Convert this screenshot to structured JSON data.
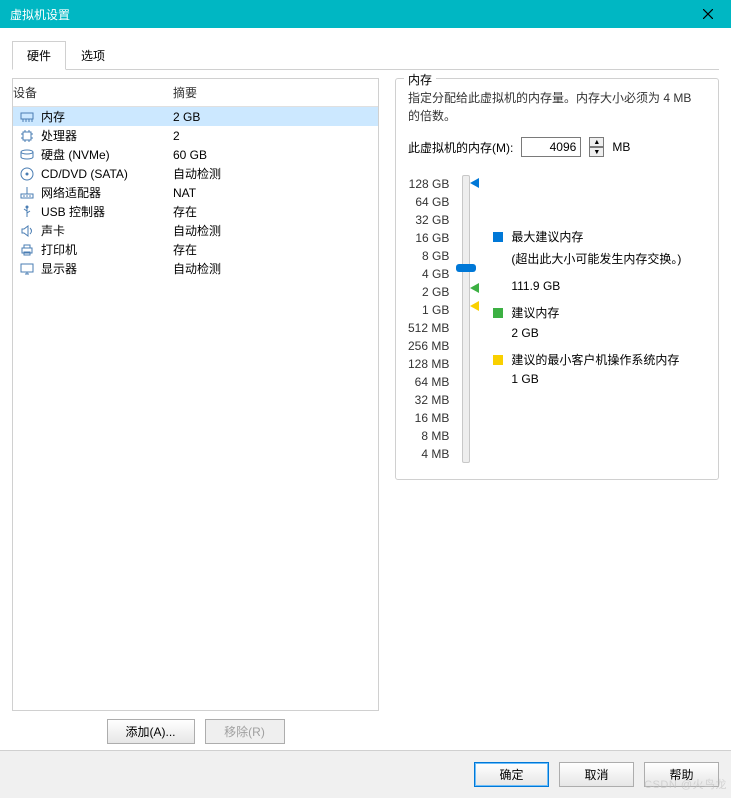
{
  "window": {
    "title": "虚拟机设置"
  },
  "tabs": {
    "hardware": "硬件",
    "options": "选项"
  },
  "hw_headers": {
    "device": "设备",
    "summary": "摘要"
  },
  "hw": [
    {
      "name": "内存",
      "summary": "2 GB",
      "icon": "memory"
    },
    {
      "name": "处理器",
      "summary": "2",
      "icon": "cpu"
    },
    {
      "name": "硬盘 (NVMe)",
      "summary": "60 GB",
      "icon": "disk"
    },
    {
      "name": "CD/DVD (SATA)",
      "summary": "自动检测",
      "icon": "cd"
    },
    {
      "name": "网络适配器",
      "summary": "NAT",
      "icon": "net"
    },
    {
      "name": "USB 控制器",
      "summary": "存在",
      "icon": "usb"
    },
    {
      "name": "声卡",
      "summary": "自动检测",
      "icon": "sound"
    },
    {
      "name": "打印机",
      "summary": "存在",
      "icon": "printer"
    },
    {
      "name": "显示器",
      "summary": "自动检测",
      "icon": "display"
    }
  ],
  "hw_buttons": {
    "add": "添加(A)...",
    "remove": "移除(R)"
  },
  "memory": {
    "group_title": "内存",
    "description": "指定分配给此虚拟机的内存量。内存大小必须为 4 MB 的倍数。",
    "label": "此虚拟机的内存(M):",
    "value": "4096",
    "unit": "MB",
    "ticks": [
      "128 GB",
      "64 GB",
      "32 GB",
      "16 GB",
      "8 GB",
      "4 GB",
      "2 GB",
      "1 GB",
      "512 MB",
      "256 MB",
      "128 MB",
      "64 MB",
      "32 MB",
      "16 MB",
      "8 MB",
      "4 MB"
    ],
    "legend": {
      "max_title": "最大建议内存",
      "max_note": "(超出此大小可能发生内存交换。)",
      "max_value": "111.9 GB",
      "rec_title": "建议内存",
      "rec_value": "2 GB",
      "min_title": "建议的最小客户机操作系统内存",
      "min_value": "1 GB"
    }
  },
  "footer": {
    "ok": "确定",
    "cancel": "取消",
    "help": "帮助"
  },
  "watermark": "CSDN @火鸟龙"
}
